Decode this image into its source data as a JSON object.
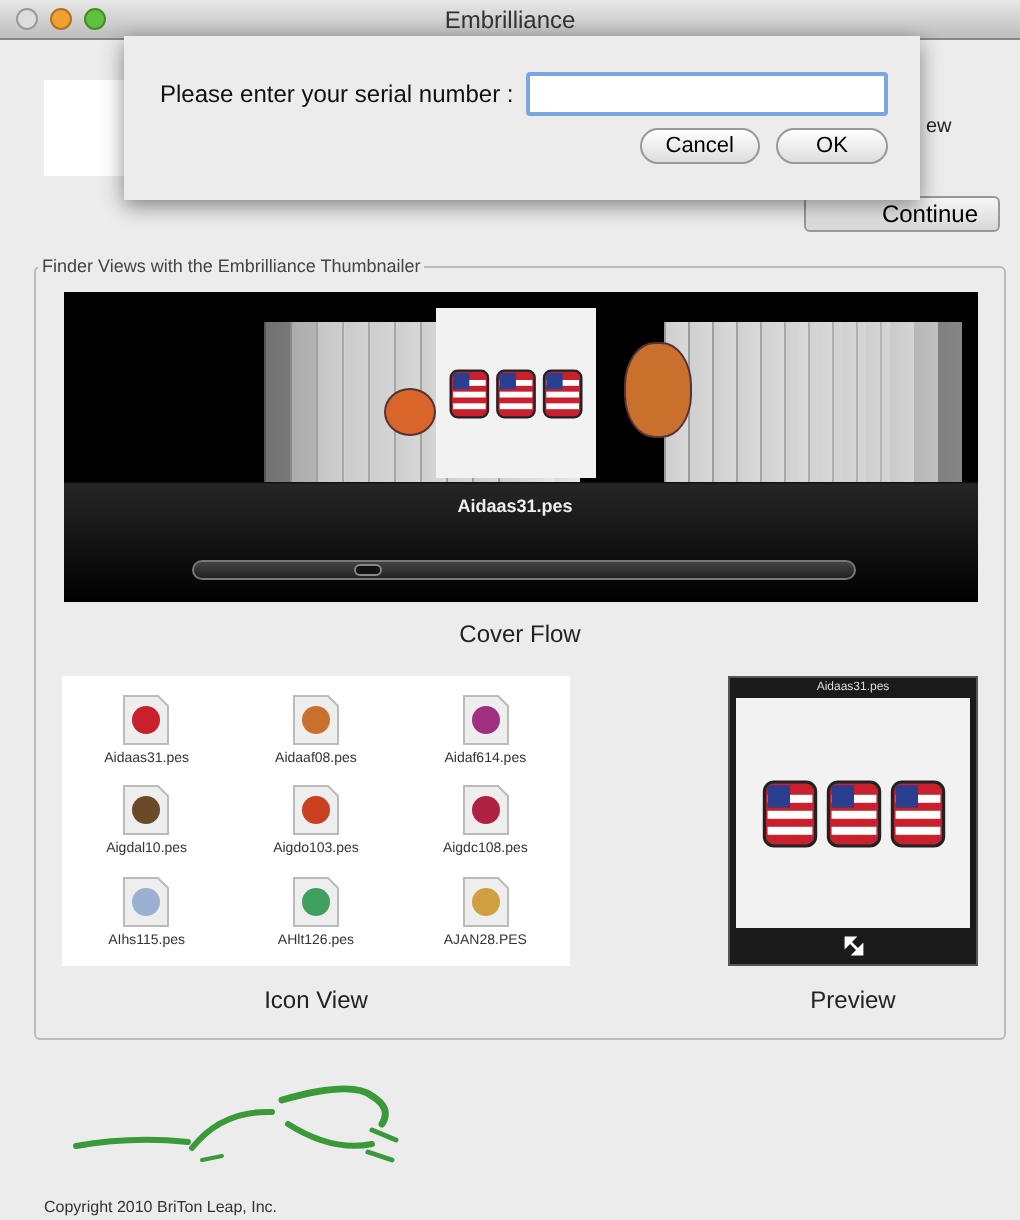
{
  "window": {
    "title": "Embrilliance"
  },
  "background_text": "ew",
  "serial_dialog": {
    "label": "Please enter your serial number :",
    "buttons": [
      "Cancel",
      "OK"
    ]
  },
  "continue_button": "Continue",
  "group": {
    "title": "Finder Views with the Embrilliance Thumbnailer",
    "cover_flow": {
      "file": "Aidaas31.pes",
      "caption": "Cover Flow"
    },
    "icon_view": {
      "caption": "Icon View",
      "files": [
        "Aidaas31.pes",
        "Aidaaf08.pes",
        "Aidaf614.pes",
        "Aigdal10.pes",
        "Aigdo103.pes",
        "Aigdc108.pes",
        "AIhs115.pes",
        "AHlt126.pes",
        "AJAN28.PES"
      ]
    },
    "preview": {
      "title": "Aidaas31.pes",
      "caption": "Preview"
    }
  },
  "copyright": "Copyright 2010 BriTon Leap, Inc."
}
